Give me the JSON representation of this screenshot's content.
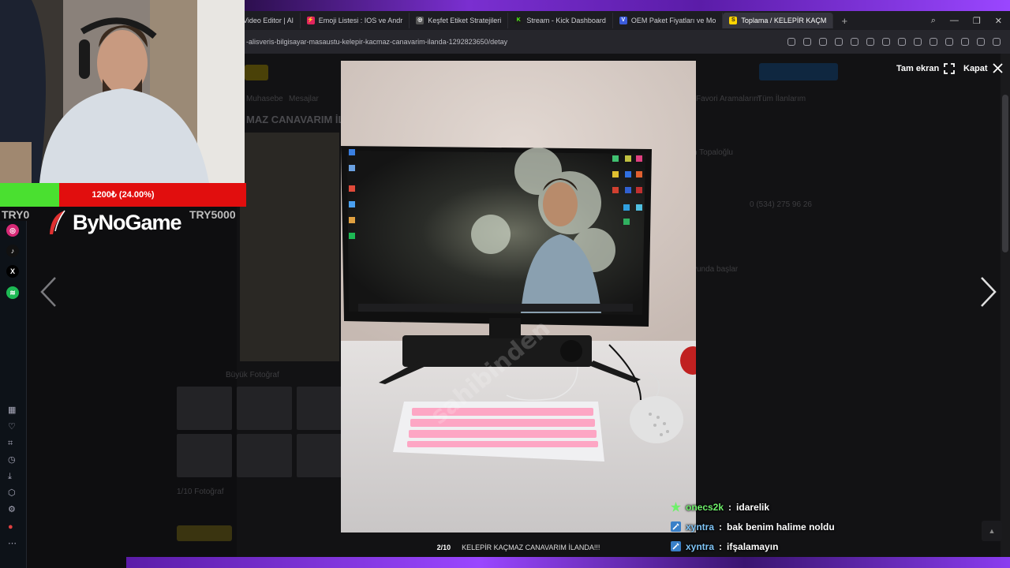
{
  "browser": {
    "tabs": [
      {
        "label": "Video Editor | Al",
        "fav": "",
        "color": "#4a8cf0"
      },
      {
        "label": "Emoji Listesi : IOS ve Andr",
        "fav": "⚡",
        "color": "#e0245e"
      },
      {
        "label": "Keşfet Etiket Stratejileri",
        "fav": "◎",
        "color": "#777"
      },
      {
        "label": "Stream - Kick Dashboard",
        "fav": "K",
        "color": "#53fc18"
      },
      {
        "label": "OEM Paket Fiyatları ve Mo",
        "fav": "V",
        "color": "#3b5bdb"
      },
      {
        "label": "Toplama / KELEPİR KAÇM",
        "fav": "S",
        "color": "#ffd400"
      }
    ],
    "new_tab": "+",
    "url": "-alisveris-bilgisayar-masaustu-kelepir-kacmaz-canavarim-ilanda-1292823650/detay"
  },
  "background_page": {
    "listing_title": "MAZ CANAVARIM İL",
    "seller_phone": "0 (534) 275 96 26",
    "big_photo_link": "Büyük Fotoğraf",
    "photo_counter": "1/10 Fotoğraf",
    "menu_items": [
      "Muhasebe",
      "Mesajlar",
      "İlanlarım",
      "Favori Aramalarım",
      "Tüm İlanlarım"
    ],
    "seller_name": "n Topaloğlu",
    "info_heading": "yunda başlar"
  },
  "lightbox": {
    "fullscreen_label": "Tam ekran",
    "close_label": "Kapat",
    "counter": "2/10",
    "caption": "KELEPİR KAÇMAZ CANAVARIM İLANDA!!!",
    "watermark": "sahibinden"
  },
  "overlay": {
    "donation": {
      "text": "1200₺ (24.00%)",
      "progress": 0.24
    },
    "goal_start": "TRY0",
    "goal_end": "TRY5000",
    "sponsor": "ByNoGame"
  },
  "chat": [
    {
      "user": "onecs2k",
      "message": "idarelik",
      "color": "#6ef06a",
      "badge": "star"
    },
    {
      "user": "xyntra",
      "message": "bak benim halime noldu",
      "color": "#7ec3f5",
      "badge": "tool"
    },
    {
      "user": "xyntra",
      "message": "ifşalamayın",
      "color": "#7ec3f5",
      "badge": "tool"
    }
  ],
  "colors": {
    "accent_purple": "#9a46ff",
    "donation_red": "#e10e0e",
    "donation_green": "#4ae030"
  }
}
